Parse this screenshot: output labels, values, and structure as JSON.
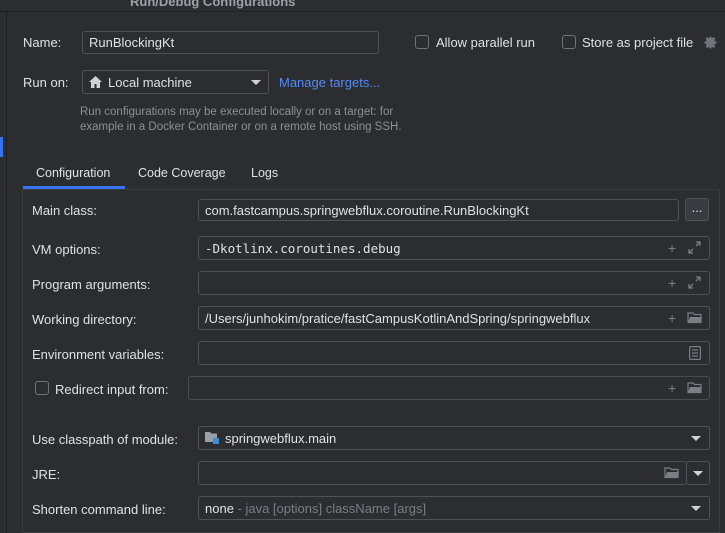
{
  "window": {
    "title": "Run/Debug Configurations"
  },
  "header": {
    "name_label": "Name:",
    "name_value": "RunBlockingKt",
    "allow_parallel_label": "Allow parallel run",
    "store_project_label": "Store as project file",
    "run_on_label": "Run on:",
    "run_on_value": "Local machine",
    "manage_targets": "Manage targets...",
    "hint_line1": "Run configurations may be executed locally or on a target: for",
    "hint_line2": "example in a Docker Container or on a remote host using SSH."
  },
  "tabs": [
    {
      "label": "Configuration",
      "active": true
    },
    {
      "label": "Code Coverage",
      "active": false
    },
    {
      "label": "Logs",
      "active": false
    }
  ],
  "config": {
    "main_class_label": "Main class:",
    "main_class_value": "com.fastcampus.springwebflux.coroutine.RunBlockingKt",
    "browse_label": "...",
    "vm_options_label": "VM options:",
    "vm_options_value": "-Dkotlinx.coroutines.debug",
    "program_args_label": "Program arguments:",
    "program_args_value": "",
    "working_dir_label": "Working directory:",
    "working_dir_value": "/Users/junhokim/pratice/fastCampusKotlinAndSpring/springwebflux",
    "env_vars_label": "Environment variables:",
    "env_vars_value": "",
    "redirect_label": "Redirect input from:",
    "redirect_value": "",
    "classpath_label": "Use classpath of module:",
    "classpath_value": "springwebflux.main",
    "jre_label": "JRE:",
    "jre_value": "",
    "shorten_label": "Shorten command line:",
    "shorten_value": "none",
    "shorten_hint": " - java [options] className [args]"
  },
  "icons": {
    "home": "home-icon",
    "expand": "expand-icon",
    "add": "add-icon",
    "folder": "folder-icon",
    "doc": "document-icon",
    "gear": "gear-icon",
    "module": "module-icon"
  },
  "colors": {
    "accent": "#3574f0",
    "link": "#548af7",
    "background": "#2b2d30"
  }
}
